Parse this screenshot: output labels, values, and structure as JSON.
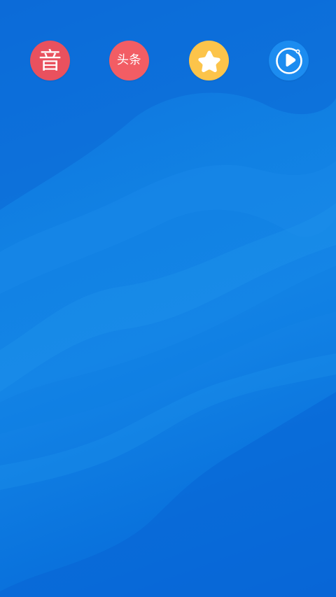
{
  "home_screen": {
    "wallpaper": {
      "base_color": "#0e6fdc",
      "highlight_color": "#1a8ae8"
    },
    "apps": [
      {
        "name": "music-app",
        "glyph": "音",
        "color": "#e9515e",
        "icon": "music-character-icon"
      },
      {
        "name": "toutiao-app",
        "glyph": "头条",
        "color": "#f25d64",
        "icon": "toutiao-text-icon"
      },
      {
        "name": "favorites-app",
        "glyph": "",
        "color": "#fcc44a",
        "icon": "star-icon"
      },
      {
        "name": "video-app",
        "glyph": "",
        "color": "#1c8cf0",
        "icon": "play-ring-icon"
      }
    ]
  }
}
